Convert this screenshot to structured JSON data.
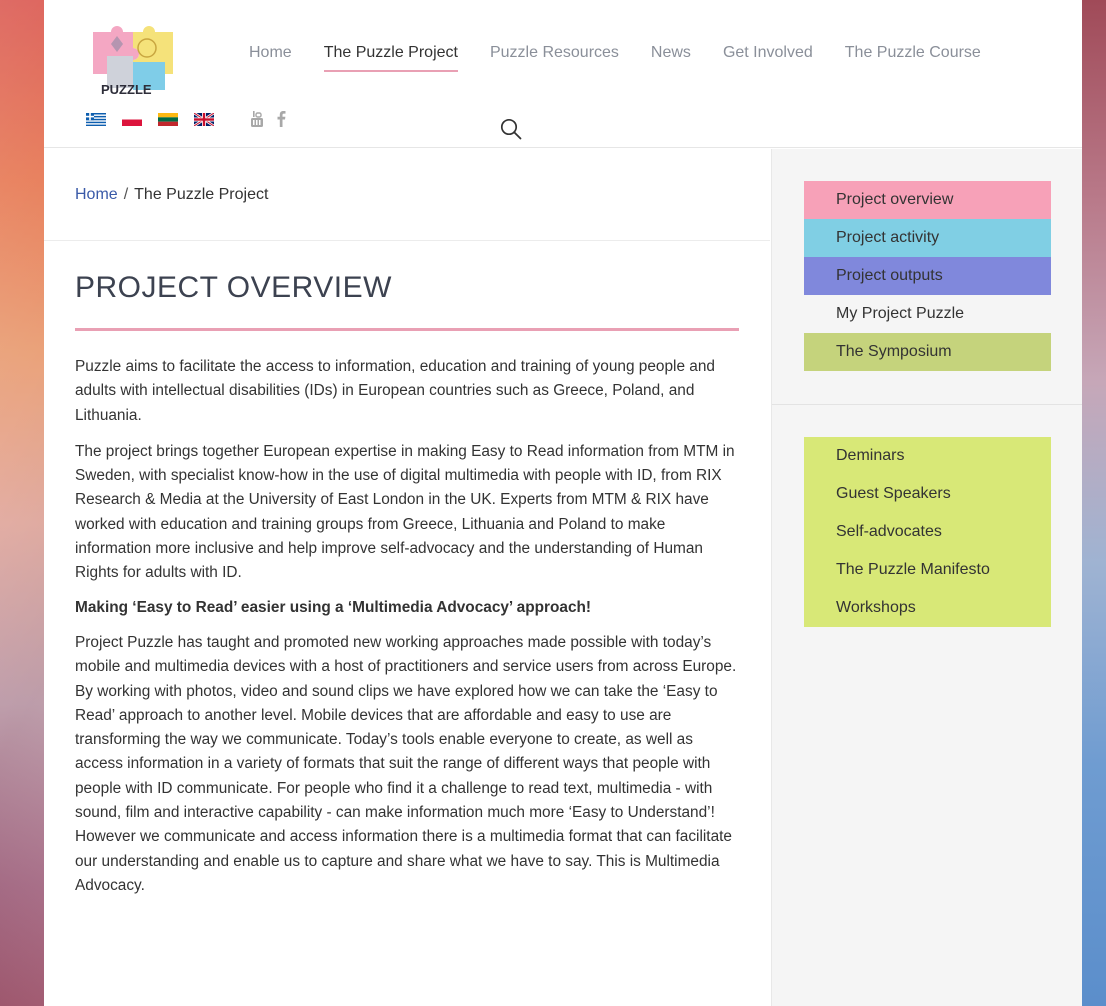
{
  "logo": {
    "text": "PUZZLE"
  },
  "nav": {
    "items": [
      "Home",
      "The Puzzle Project",
      "Puzzle Resources",
      "News",
      "Get Involved",
      "The Puzzle Course"
    ],
    "active_index": 1
  },
  "flags": [
    "greece-flag",
    "poland-flag",
    "lithuania-flag",
    "uk-flag"
  ],
  "social": [
    "youtube-icon",
    "facebook-icon"
  ],
  "breadcrumb": {
    "home": "Home",
    "separator": "/",
    "current": "The Puzzle Project"
  },
  "page": {
    "title": "PROJECT OVERVIEW",
    "paragraphs": [
      "Puzzle aims to facilitate the access to information, education and training of young people and adults with intellectual disabilities (IDs) in European countries such as Greece, Poland, and Lithuania.",
      "The project brings together European expertise in making Easy to Read information from MTM in Sweden, with specialist know-how in the use of digital multimedia with people with ID, from RIX Research & Media at the University of East London in the UK. Experts from MTM & RIX have worked with education and training groups from Greece, Lithuania and Poland to make information more inclusive and help improve self-advocacy and the understanding of Human Rights for adults with ID.",
      "Making ‘Easy to Read’ easier using a ‘Multimedia Advocacy’ approach!",
      "Project Puzzle has taught and promoted new working approaches made possible with today’s mobile and multimedia devices with a host of practitioners and service users from across Europe. By working with photos, video and sound clips we have explored how we can take the ‘Easy to Read’ approach to another level. Mobile devices that are affordable and easy to use are transforming the way we communicate. Today’s tools enable everyone to create, as well as access information in a variety of formats that suit the range of different ways that people with people with ID communicate. For people who find it a challenge to read text, multimedia - with sound, film and interactive capability - can make information much more ‘Easy to Understand’!",
      "However we communicate and access information there is a multimedia format that can facilitate our understanding and enable us to capture and share what we have to say. This is Multimedia Advocacy."
    ]
  },
  "sidebar": {
    "menu1": [
      {
        "label": "Project overview",
        "color": "#f7a1b8"
      },
      {
        "label": "Project activity",
        "color": "#80cfe4"
      },
      {
        "label": "Project outputs",
        "color": "#8088dc"
      },
      {
        "label": "My Project Puzzle",
        "color": "transparent"
      },
      {
        "label": "The Symposium",
        "color": "#c5d37c"
      }
    ],
    "menu2": {
      "color": "#d8e877",
      "items": [
        "Deminars",
        "Guest Speakers",
        "Self-advocates",
        "The Puzzle Manifesto",
        "Workshops"
      ]
    }
  },
  "colors": {
    "accent_pink": "#e9a0b4",
    "link_blue": "#3a5aa8"
  }
}
